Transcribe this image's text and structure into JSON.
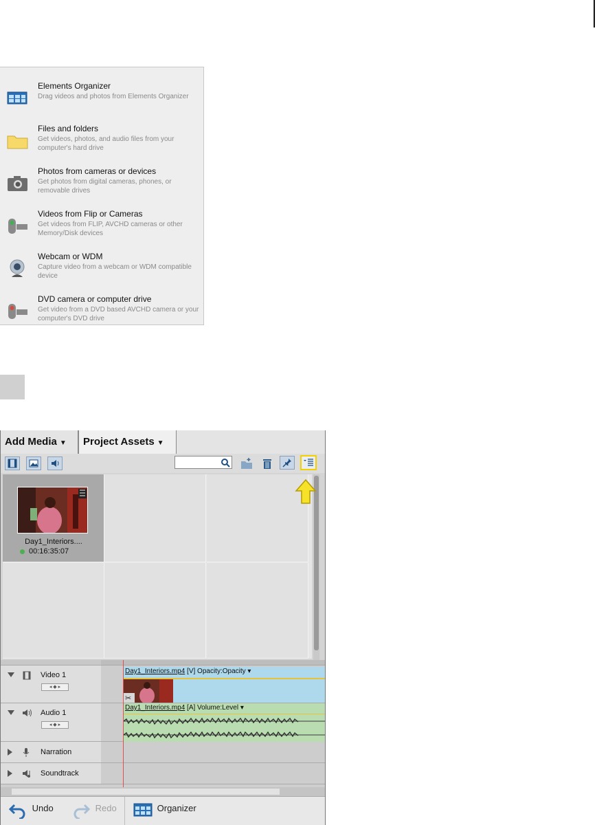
{
  "add_media_menu": {
    "items": [
      {
        "title": "Elements Organizer",
        "desc": "Drag videos and photos from Elements Organizer",
        "icon": "grid-organizer-icon"
      },
      {
        "title": "Files and folders",
        "desc": "Get videos, photos, and audio files from your computer's hard drive",
        "icon": "folder-icon"
      },
      {
        "title": "Photos from cameras or devices",
        "desc": "Get photos from digital cameras, phones, or removable drives",
        "icon": "camera-icon"
      },
      {
        "title": "Videos from Flip or Cameras",
        "desc": "Get videos from FLIP, AVCHD cameras or other Memory/Disk devices",
        "icon": "camcorder-icon"
      },
      {
        "title": "Webcam or WDM",
        "desc": "Capture video from a webcam or WDM compatible device",
        "icon": "webcam-icon"
      },
      {
        "title": "DVD camera or computer drive",
        "desc": "Get video from a DVD based AVCHD camera or your computer's DVD drive",
        "icon": "dvd-camcorder-icon"
      }
    ]
  },
  "editor": {
    "tabs": {
      "add_media": "Add Media",
      "project_assets": "Project Assets"
    },
    "search": {
      "placeholder": ""
    },
    "asset": {
      "name": "Day1_Interiors....",
      "duration": "00:16:35:07"
    },
    "tracks": {
      "video1": {
        "label": "Video 1",
        "clip_file": "Day1_Interiors.mp4",
        "clip_tag": "[V] Opacity:Opacity"
      },
      "audio1": {
        "label": "Audio 1",
        "clip_file": "Day1_Interiors.mp4",
        "clip_tag": "[A] Volume:Level"
      },
      "narration": {
        "label": "Narration"
      },
      "soundtrack": {
        "label": "Soundtrack"
      }
    },
    "actions": {
      "undo": "Undo",
      "redo": "Redo",
      "organizer": "Organizer"
    }
  },
  "colors": {
    "highlight": "#f5d000",
    "video_clip": "#aed8ec",
    "audio_clip": "#b9dcb0",
    "playhead": "#e05050"
  }
}
